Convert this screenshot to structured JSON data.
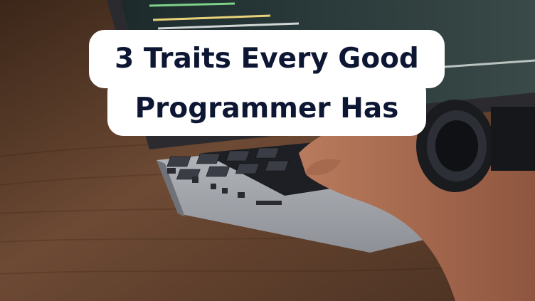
{
  "headline": {
    "line1": "3 Traits Every Good",
    "line2": "Programmer Has"
  },
  "colors": {
    "text": "#0d1733",
    "panel": "#ffffff",
    "desk": "#6b4a33"
  }
}
